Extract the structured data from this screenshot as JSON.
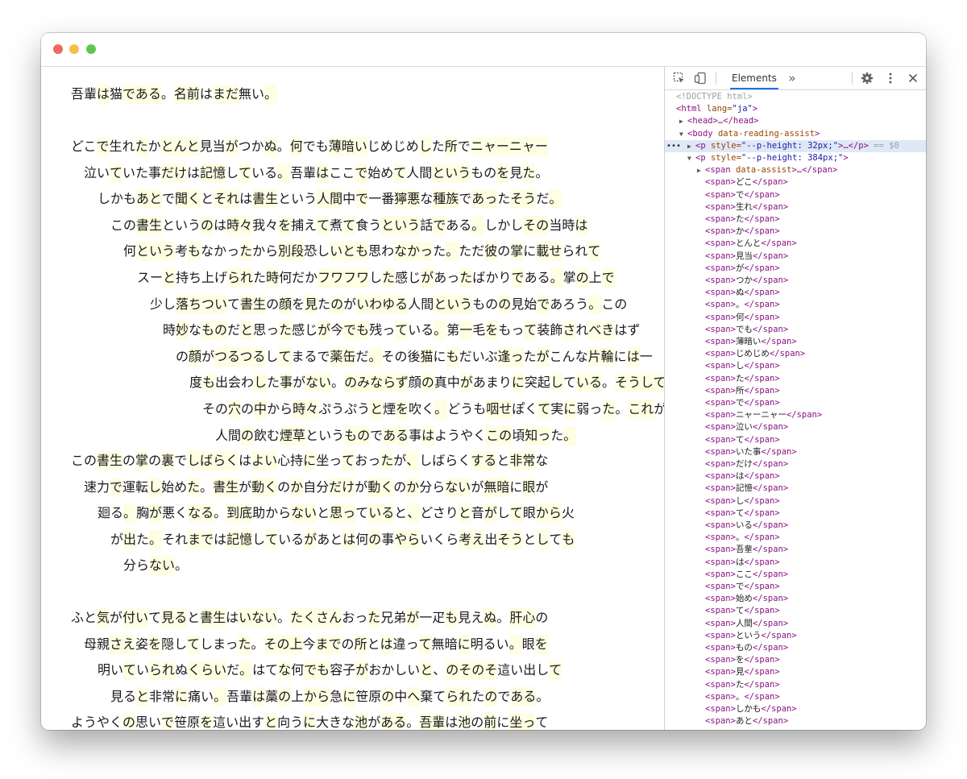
{
  "page": {
    "paragraphs": [
      [
        [
          "吾輩",
          "は",
          "猫",
          "である",
          "。",
          "名前",
          "は",
          "まだ",
          "無い",
          "。"
        ]
      ],
      [
        [
          "どこ",
          "で",
          "生れ",
          "た",
          "か",
          "とんと",
          "見当",
          "が",
          "つか",
          "ぬ",
          "。",
          "何",
          "でも",
          "薄暗い",
          "じめじめ",
          "し",
          "た",
          "所",
          "で",
          "ニャーニャー"
        ],
        [
          "泣い",
          "て",
          "いた事",
          "だけ",
          "は",
          "記憶",
          "し",
          "て",
          "いる",
          "。",
          "吾輩",
          "は",
          "ここ",
          "で",
          "始め",
          "て",
          "人間",
          "という",
          "もの",
          "を",
          "見",
          "た",
          "。"
        ],
        [
          "しかも",
          "あと",
          "で",
          "聞く",
          "と",
          "それ",
          "は",
          "書生",
          "という",
          "人間",
          "中",
          "で",
          "一番",
          "獰悪",
          "な",
          "種族",
          "で",
          "あっ",
          "た",
          "そう",
          "だ",
          "。"
        ],
        [
          "この",
          "書生",
          "という",
          "の",
          "は",
          "時々",
          "我々",
          "を",
          "捕え",
          "て",
          "煮",
          "て",
          "食う",
          "という",
          "話",
          "で",
          "ある",
          "。",
          "しかし",
          "その",
          "当時",
          "は"
        ],
        [
          "何",
          "という",
          "考",
          "も",
          "なかっ",
          "た",
          "から",
          "別段",
          "恐し",
          "いとも",
          "思わ",
          "なかっ",
          "た",
          "。",
          "ただ",
          "彼",
          "の",
          "掌",
          "に",
          "載せ",
          "られ",
          "て"
        ],
        [
          "スー",
          "と",
          "持ち上げ",
          "られ",
          "た",
          "時",
          "何だか",
          "フワフワ",
          "し",
          "た",
          "感じ",
          "が",
          "あっ",
          "た",
          "ばかり",
          "で",
          "ある",
          "。",
          "掌",
          "の",
          "上",
          "で"
        ],
        [
          "少し",
          "落ちつい",
          "て",
          "書生",
          "の",
          "顔",
          "を",
          "見",
          "た",
          "の",
          "が",
          "いわゆる",
          "人間",
          "という",
          "もの",
          "の",
          "見始",
          "で",
          "あろう",
          "。",
          "この"
        ],
        [
          "時",
          "妙",
          "な",
          "もの",
          "だ",
          "と",
          "思っ",
          "た",
          "感じ",
          "が",
          "今",
          "でも",
          "残っ",
          "て",
          "いる",
          "。",
          "第",
          "一",
          "毛",
          "を",
          "もっ",
          "て",
          "装飾",
          "さ",
          "れ",
          "べき",
          "はず"
        ],
        [
          "の",
          "顔",
          "が",
          "つるつる",
          "し",
          "て",
          "まるで",
          "薬缶",
          "だ",
          "。",
          "その後",
          "猫",
          "に",
          "も",
          "だいぶ",
          "逢っ",
          "た",
          "が",
          "こんな",
          "片輪",
          "に",
          "は",
          "一"
        ],
        [
          "度",
          "も",
          "出会わ",
          "し",
          "た",
          "事",
          "が",
          "ない",
          "。",
          "のみならず",
          "顔",
          "の",
          "真中",
          "が",
          "あまり",
          "に",
          "突起",
          "し",
          "て",
          "いる",
          "。",
          "そうして"
        ],
        [
          "その",
          "穴",
          "の",
          "中",
          "から",
          "時々",
          "ぷうぷう",
          "と",
          "煙",
          "を",
          "吹く",
          "。",
          "どうも",
          "咽せ",
          "ぽく",
          "て",
          "実",
          "に",
          "弱っ",
          "た",
          "。",
          "これ",
          "が"
        ],
        [
          "人間",
          "の",
          "飲む",
          "煙草",
          "という",
          "もの",
          "で",
          "ある",
          "事",
          "は",
          "ようやく",
          "この",
          "頃",
          "知っ",
          "た",
          "。"
        ]
      ],
      [
        [
          "この",
          "書生",
          "の",
          "掌",
          "の",
          "裏",
          "で",
          "しばらく",
          "は",
          "よい",
          "心持",
          "に",
          "坐っ",
          "て",
          "おっ",
          "た",
          "が",
          "、",
          "しばらく",
          "する",
          "と",
          "非常",
          "な"
        ],
        [
          "速力",
          "で",
          "運転",
          "し",
          "始め",
          "た",
          "。",
          "書生",
          "が",
          "動く",
          "の",
          "か",
          "自分",
          "だけ",
          "が",
          "動く",
          "の",
          "か",
          "分ら",
          "ない",
          "が",
          "無暗",
          "に",
          "眼",
          "が"
        ],
        [
          "廻る",
          "。",
          "胸",
          "が",
          "悪く",
          "なる",
          "。",
          "到底",
          "助から",
          "ない",
          "と",
          "思っ",
          "て",
          "いる",
          "と",
          "、",
          "どさり",
          "と",
          "音",
          "が",
          "し",
          "て",
          "眼",
          "から",
          "火"
        ],
        [
          "が",
          "出",
          "た",
          "。",
          "それ",
          "まで",
          "は",
          "記憶",
          "し",
          "て",
          "いる",
          "が",
          "あと",
          "は",
          "何",
          "の",
          "事",
          "やら",
          "いくら",
          "考え",
          "出",
          "そう",
          "と",
          "し",
          "て",
          "も"
        ],
        [
          "分ら",
          "ない",
          "。"
        ]
      ],
      [
        [
          "ふと",
          "気",
          "が",
          "付い",
          "て",
          "見る",
          "と",
          "書生",
          "は",
          "いない",
          "。",
          "たくさん",
          "おっ",
          "た",
          "兄弟",
          "が",
          "一疋",
          "も",
          "見え",
          "ぬ",
          "。",
          "肝心",
          "の"
        ],
        [
          "母親",
          "さえ",
          "姿",
          "を",
          "隠し",
          "て",
          "しまっ",
          "た",
          "。",
          "その上",
          "今",
          "まで",
          "の",
          "所",
          "と",
          "は",
          "違っ",
          "て",
          "無暗",
          "に",
          "明るい",
          "。",
          "眼",
          "を"
        ],
        [
          "明い",
          "て",
          "い",
          "られ",
          "ぬ",
          "くらい",
          "だ",
          "。",
          "はて",
          "な",
          "何",
          "でも",
          "容子",
          "が",
          "おかしい",
          "と",
          "、",
          "のそのそ",
          "這い出し",
          "て"
        ],
        [
          "見る",
          "と",
          "非常",
          "に",
          "痛い",
          "。",
          "吾輩",
          "は",
          "藁",
          "の",
          "上",
          "から",
          "急",
          "に",
          "笹原",
          "の",
          "中",
          "へ",
          "棄て",
          "られ",
          "た",
          "の",
          "で",
          "ある",
          "。"
        ]
      ],
      [
        [
          "ようやく",
          "の",
          "思い",
          "で",
          "笹原",
          "を",
          "這い出す",
          "と",
          "向う",
          "に",
          "大きな",
          "池",
          "が",
          "ある",
          "。",
          "吾輩",
          "は",
          "池",
          "の",
          "前",
          "に",
          "坐っ",
          "て"
        ]
      ]
    ]
  },
  "devtools": {
    "tab_elements": "Elements",
    "more_tabs": "»",
    "dom": [
      {
        "kind": "doctype",
        "text": "<!DOCTYPE html>"
      },
      {
        "kind": "open",
        "tag": "html",
        "attrs": " lang=",
        "attrval": "\"ja\"",
        "close": ">"
      },
      {
        "kind": "collapsed",
        "tag": "head",
        "text": "<head>…</head>"
      },
      {
        "kind": "open2",
        "tag": "body",
        "text": "<body data-reading-assist>"
      },
      {
        "kind": "selp",
        "text": "<p style=\"--p-height: 32px;\">…</p>",
        "suffix": " == $0"
      },
      {
        "kind": "openp",
        "text": "<p style=\"--p-height: 384px;\">"
      },
      {
        "kind": "assist",
        "text": "<span data-assist>…</span>"
      }
    ],
    "spans": [
      "どこ",
      "で",
      "生れ",
      "た",
      "か",
      "とんと",
      "見当",
      "が",
      "つか",
      "ぬ",
      "。",
      "何",
      "でも",
      "薄暗い",
      "じめじめ",
      "し",
      "た",
      "所",
      "で",
      "ニャーニャー",
      "泣い",
      "て",
      "いた事",
      "だけ",
      "は",
      "記憶",
      "し",
      "て",
      "いる",
      "。",
      "吾輩",
      "は",
      "ここ",
      "で",
      "始め",
      "て",
      "人間",
      "という",
      "もの",
      "を",
      "見",
      "た",
      "。",
      "しかも",
      "あと"
    ]
  }
}
